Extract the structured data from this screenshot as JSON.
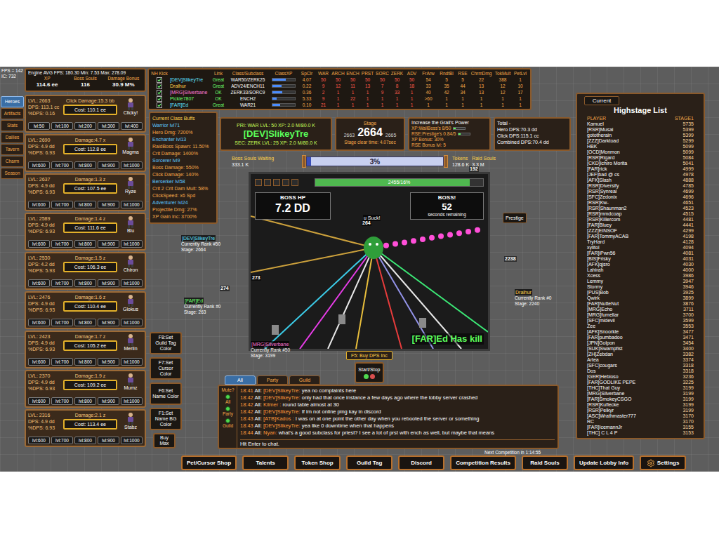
{
  "engine": {
    "fps": "FPS = 142",
    "ic": "IC: 732",
    "avg": "Engine AVG FPS: 180.30 Min: 7.53 Max: 278.09"
  },
  "summary": [
    {
      "label": "XP",
      "value": "114.6 ee"
    },
    {
      "label": "Boss Souls",
      "value": "116"
    },
    {
      "label": "Damage Bonus",
      "value": "30.9 M%"
    }
  ],
  "side_tabs": [
    {
      "label": "Heroes",
      "selected": true
    },
    {
      "label": "Artifacts",
      "selected": false
    },
    {
      "label": "Stats",
      "selected": false
    },
    {
      "label": "Dailies",
      "selected": false
    },
    {
      "label": "Tavern",
      "selected": false
    },
    {
      "label": "Charm",
      "selected": false
    },
    {
      "label": "Season",
      "selected": false
    }
  ],
  "heroes": [
    {
      "name": "Clicky!",
      "lvl": "LVL: 2663",
      "dps": "DPS: 113.1 cc",
      "pct": "%DPS: 0.16",
      "damage": "Click Damage:15.3 bb",
      "cost": "Cost: 110.1 ee",
      "levels": [
        "lvl:50",
        "lvl:100",
        "lvl:200",
        "lvl:300",
        "lvl:400"
      ]
    },
    {
      "name": "Magma",
      "lvl": "LVL: 2690",
      "dps": "DPS: 4.9 dd",
      "pct": "%DPS: 6.93",
      "damage": "Damage:4.7 x",
      "cost": "Cost: 112.8 ee",
      "levels": [
        "lvl:600",
        "lvl:700",
        "lvl:800",
        "lvl:900",
        "lvl:1000"
      ]
    },
    {
      "name": "Ryze",
      "lvl": "LVL: 2637",
      "dps": "DPS: 4.9 dd",
      "pct": "%DPS: 6.93",
      "damage": "Damage:1.3 z",
      "cost": "Cost: 107.5 ee",
      "levels": [
        "lvl:600",
        "lvl:700",
        "lvl:800",
        "lvl:900",
        "lvl:1000"
      ]
    },
    {
      "name": "Blu",
      "lvl": "LVL: 2589",
      "dps": "DPS: 4.9 dd",
      "pct": "%DPS: 6.93",
      "damage": "Damage:1.4 z",
      "cost": "Cost: 111.6 ee",
      "levels": [
        "lvl:600",
        "lvl:700",
        "lvl:800",
        "lvl:900",
        "lvl:1000"
      ]
    },
    {
      "name": "Chiron",
      "lvl": "LVL: 2530",
      "dps": "DPS: 4.2 dd",
      "pct": "%DPS: 5.93",
      "damage": "Damage:1.5 z",
      "cost": "Cost: 106.3 ee",
      "levels": [
        "lvl:600",
        "lvl:700",
        "lvl:800",
        "lvl:900",
        "lvl:1000"
      ]
    },
    {
      "name": "Glokus",
      "lvl": "LVL: 2476",
      "dps": "DPS: 4.9 dd",
      "pct": "%DPS: 6.93",
      "damage": "Damage:1.6 z",
      "cost": "Cost: 110.4 ee",
      "levels": [
        "lvl:600",
        "lvl:700",
        "lvl:800",
        "lvl:900",
        "lvl:1000"
      ]
    },
    {
      "name": "Merlin",
      "lvl": "LVL: 2423",
      "dps": "DPS: 4.9 dd",
      "pct": "%DPS: 6.93",
      "damage": "Damage:1.7 z",
      "cost": "Cost: 105.2 ee",
      "levels": [
        "lvl:600",
        "lvl:700",
        "lvl:800",
        "lvl:900",
        "lvl:1000"
      ]
    },
    {
      "name": "Mumz",
      "lvl": "LVL: 2370",
      "dps": "DPS: 4.9 dd",
      "pct": "%DPS: 6.93",
      "damage": "Damage:1.9 z",
      "cost": "Cost: 109.2 ee",
      "levels": [
        "lvl:600",
        "lvl:700",
        "lvl:800",
        "lvl:900",
        "lvl:1000"
      ]
    },
    {
      "name": "Stabz",
      "lvl": "LVL: 2316",
      "dps": "DPS: 4.9 dd",
      "pct": "%DPS: 6.93",
      "damage": "Damage:2.1 z",
      "cost": "Cost: 113.4 ee",
      "levels": [
        "lvl:600",
        "lvl:700",
        "lvl:800",
        "lvl:900",
        "lvl:1000"
      ]
    }
  ],
  "party": {
    "columns": [
      "NH Kick",
      "Link",
      "Class/Subclass",
      "ClassXP",
      "SpClr",
      "WAR",
      "ARCH",
      "ENCH",
      "PRST",
      "SORC",
      "ZERK",
      "ADV",
      "FrArw",
      "RndtBl",
      "RSE",
      "ChrmDmg",
      "TokMult",
      "PetLvl"
    ],
    "rows": [
      {
        "kick": true,
        "name": "[DEV]SlikeyTre",
        "color": "#5ee0ff",
        "link": "Great",
        "class": "WAR50/ZERK25",
        "level": 0.6,
        "values": [
          "4.07",
          "50",
          "50",
          "50",
          "50",
          "50",
          "50",
          "50",
          "54",
          "5",
          "5",
          "22",
          "388",
          "1"
        ]
      },
      {
        "kick": true,
        "name": "Dralhur",
        "color": "#ffd24a",
        "link": "Great",
        "class": "ADV24/ENCH11",
        "level": 0.4,
        "values": [
          "0.22",
          "9",
          "12",
          "11",
          "13",
          "7",
          "8",
          "18",
          "33",
          "35",
          "44",
          "13",
          "12",
          "10"
        ]
      },
      {
        "kick": true,
        "name": "[MRG]Silverbane",
        "color": "#ff7ad9",
        "link": "OK",
        "class": "ZERK33/SORC9",
        "level": 0.45,
        "values": [
          "0.36",
          "2",
          "1",
          "1",
          "1",
          "9",
          "33",
          "1",
          "40",
          "42",
          "34",
          "13",
          "12",
          "17"
        ]
      },
      {
        "kick": true,
        "name": "Pickle7807",
        "color": "#6dff6d",
        "link": "OK",
        "class": "ENCH2",
        "level": 0.2,
        "values": [
          "5.33",
          "9",
          "1",
          "22",
          "1",
          "1",
          "1",
          "1",
          ">60",
          "1",
          "1",
          "1",
          "1",
          "1"
        ]
      },
      {
        "kick": true,
        "name": "[FAR]Ed",
        "color": "#5ee0ff",
        "link": "Great",
        "class": "WAR21",
        "level": 0.35,
        "values": [
          "0.10",
          "21",
          "1",
          "1",
          "1",
          "1",
          "1",
          "1",
          "1",
          "1",
          "1",
          "1",
          "1",
          "1"
        ]
      }
    ]
  },
  "buffs": {
    "title": "Current Class Buffs",
    "lines": [
      {
        "text": "Warrior lvl71",
        "kind": "class"
      },
      {
        "text": "Hero Dmg: 7200%",
        "kind": "buff"
      },
      {
        "text": "Enchanter lvl13",
        "kind": "class"
      },
      {
        "text": "RaidBoss Spawn: 11.50%",
        "kind": "buff"
      },
      {
        "text": "Crit Damage: 1400%",
        "kind": "buff"
      },
      {
        "text": "Sorcerer lvl9",
        "kind": "class"
      },
      {
        "text": "Boss Damage: 550%",
        "kind": "buff"
      },
      {
        "text": "Click Damage: 140%",
        "kind": "buff"
      },
      {
        "text": "Berserker lvl58",
        "kind": "class"
      },
      {
        "text": "Crit 2 Crit Dam Mult: 58%",
        "kind": "buff"
      },
      {
        "text": "ClickSpeed: x6 Spd",
        "kind": "buff"
      },
      {
        "text": "Adventurer lvl24",
        "kind": "class"
      },
      {
        "text": "Projectile Dmg: 27%",
        "kind": "buff"
      },
      {
        "text": "XP Gain Inc: 3700%",
        "kind": "buff"
      }
    ]
  },
  "primary": {
    "pri": "PRI: WAR LVL: 50 XP: 2.0 M/80.0 K",
    "name": "[DEV]SlikeyTre",
    "sec": "SEC: ZERK LVL: 25 XP: 2.0 M/80.0 K"
  },
  "stage": {
    "label": "Stage",
    "prev": "2663",
    "current": "2664",
    "next": "2665",
    "clear": "Stage clear time: 4.07sec"
  },
  "grail": {
    "title": "Increase the Grail's Power",
    "bars": [
      {
        "text": "XP:WallBoss's 8/50",
        "level": 0.16
      },
      {
        "text": "RSE:Prestige's 0.84/5",
        "level": 0.17
      }
    ],
    "lines": [
      "XP Bonus: 30%",
      "RSE Bonus lvl: 5"
    ]
  },
  "total": {
    "title": "Total -",
    "lines": [
      "Hero DPS:70.3 dd",
      "Click DPS:115.1 cc",
      "Combined DPS:70.4 dd"
    ]
  },
  "souls": {
    "waiting": {
      "label": "Boss Souls Waiting",
      "value": "333.1 K"
    },
    "progress": {
      "label": "3%",
      "level": 0.03
    },
    "tokens": {
      "label": "Tokens",
      "value": "128.6 K"
    },
    "raid": {
      "label": "Raid Souls",
      "value": "3.3 M"
    }
  },
  "arena": {
    "hp_bar": {
      "label": "2455/16%",
      "level": 0.92
    },
    "boss_hp": {
      "label": "BOSS HP",
      "value": "7.2 DD"
    },
    "timer": {
      "label": "BOSS!",
      "value": "52",
      "caption": "seconds remaining"
    },
    "kill": "[FAR]Ed Has kill",
    "taunt": "u Suck!"
  },
  "prestige": "Prestige",
  "players": [
    {
      "name": "[DEV]SlikeyTre",
      "rank": "Currently Rank #50",
      "stage": "Stage: 2664",
      "color": "#5ee0ff"
    },
    {
      "name": "[FAR]Ed",
      "rank": "Currently Rank #0",
      "stage": "Stage: 263",
      "color": "#6dff6d"
    },
    {
      "name": "[MRG]Silverbane",
      "rank": "Currently Rank #50",
      "stage": "Stage: 3199",
      "color": "#ff7ad9"
    },
    {
      "name": "Dralhur",
      "rank": "Currently Rank #0",
      "stage": "Stage: 2240",
      "color": "#ffd24a"
    }
  ],
  "floaters": [
    "264",
    "273",
    "274",
    "2238",
    "192"
  ],
  "guild_buttons": [
    "F8:Set Guild Tag Color",
    "F7:Set Cursor Color",
    "F6:Set Name Color",
    "F1:Set Name BG Color"
  ],
  "buy": {
    "label": "Buy",
    "value": "Max"
  },
  "f5": "F5: Buy DPS Inc",
  "start_stop": "Start/Stop",
  "chat": {
    "tabs": [
      {
        "label": "All",
        "selected": true
      },
      {
        "label": "Party",
        "selected": false
      },
      {
        "label": "Guild",
        "selected": false
      }
    ],
    "mute": {
      "label": "Mute?",
      "options": [
        {
          "label": "All",
          "on": true
        },
        {
          "label": "Party",
          "on": true
        },
        {
          "label": "Guild",
          "on": true
        }
      ]
    },
    "messages": [
      {
        "time": "18:41",
        "channel": "All:",
        "name": "[DEV]SlikeyTre:",
        "text": "yea no complaints here"
      },
      {
        "time": "18:42",
        "channel": "All:",
        "name": "[DEV]SlikeyTre:",
        "text": "only had that once instance a few days ago where the lobby server crashed"
      },
      {
        "time": "18:42",
        "channel": "All:",
        "name": "Kilmer :",
        "text": "round table almost at 30"
      },
      {
        "time": "18:42",
        "channel": "All:",
        "name": "[DEV]SlikeyTre:",
        "text": "If im not online ping kay in discord"
      },
      {
        "time": "18:43",
        "channel": "All:",
        "name": "[ATB]Kados :",
        "text": "I was on at one point the other day when you rebooted the server or something"
      },
      {
        "time": "18:43",
        "channel": "All:",
        "name": "[DEV]SlikeyTre:",
        "text": "yea like 0 downtime when that happens"
      },
      {
        "time": "18:44",
        "channel": "All:",
        "name": "Nyan:",
        "text": "what's a good subclass for priest? I see a lot of prst with ench as well, but maybe that means"
      }
    ],
    "input": "Hit Enter to chat."
  },
  "highstage": {
    "button": "Current",
    "title": "Highstage List",
    "columns": [
      "PLAYER",
      "STAGE1"
    ],
    "rows": [
      {
        "player": "Kamuel",
        "stage": "5735"
      },
      {
        "player": "[RSR]Musai",
        "stage": "5399"
      },
      {
        "player": "gototherain",
        "stage": "5399"
      },
      {
        "player": "[ZZZ]Darktoad",
        "stage": "5299"
      },
      {
        "player": "HBK",
        "stage": "5099"
      },
      {
        "player": "[OCD]Monmon",
        "stage": "5099"
      },
      {
        "player": "[RSR]Rigard",
        "stage": "5084"
      },
      {
        "player": "[CKD]Ichiro Morita",
        "stage": "5041"
      },
      {
        "player": "[FAR]rick",
        "stage": "4999"
      },
      {
        "player": "[JEF]bad @ cs",
        "stage": "4978"
      },
      {
        "player": "[AFK]Slash",
        "stage": "4888"
      },
      {
        "player": "[RSR]Diversify",
        "stage": "4785"
      },
      {
        "player": "[RSR]Synreal",
        "stage": "4699"
      },
      {
        "player": "[SFC]Zedonix",
        "stage": "4696"
      },
      {
        "player": "[RSR]Kw-",
        "stage": "4651"
      },
      {
        "player": "[RSR]Shaunman2",
        "stage": "4523"
      },
      {
        "player": "[RSR]mmdcoap",
        "stage": "4515"
      },
      {
        "player": "[RSR]Killercom",
        "stage": "4481"
      },
      {
        "player": "[FAR]Bluey",
        "stage": "4441"
      },
      {
        "player": "[ZZZ]EINSOF",
        "stage": "4299"
      },
      {
        "player": "[FAR]TommyACAB",
        "stage": "4198"
      },
      {
        "player": "TryHard",
        "stage": "4128"
      },
      {
        "player": "xylitol",
        "stage": "4094"
      },
      {
        "player": "[FAR]iPwn56",
        "stage": "4081"
      },
      {
        "player": "[BIS]Frisky",
        "stage": "4031"
      },
      {
        "player": "[AFK]qjsro",
        "stage": "4030"
      },
      {
        "player": "Lahirah",
        "stage": "4000"
      },
      {
        "player": "Xcess",
        "stage": "3986"
      },
      {
        "player": "Lemmy",
        "stage": "3947"
      },
      {
        "player": "Stormy",
        "stage": "3946"
      },
      {
        "player": "[PUS]Bob",
        "stage": "3925"
      },
      {
        "player": "Qwirk",
        "stage": "3899"
      },
      {
        "player": "[FAR]NutteNut",
        "stage": "3876"
      },
      {
        "player": "[MRG]Echo",
        "stage": "3711"
      },
      {
        "player": "[MRG]fumellar",
        "stage": "3700"
      },
      {
        "player": "[SFC]midevil",
        "stage": "3599"
      },
      {
        "player": "Zee",
        "stage": "3553"
      },
      {
        "player": "[AFK]Snoorkle",
        "stage": "3477"
      },
      {
        "player": "[FAR]pumbadoo",
        "stage": "3471"
      },
      {
        "player": "[JPN]Golpon",
        "stage": "3454"
      },
      {
        "player": "[SUK]Swampfist",
        "stage": "3400"
      },
      {
        "player": "[ZH]Zebdan",
        "stage": "3382"
      },
      {
        "player": "Artea",
        "stage": "3374"
      },
      {
        "player": "[SFC]cougars",
        "stage": "3318"
      },
      {
        "player": "Dos",
        "stage": "3318"
      },
      {
        "player": "[GER]Hebioso",
        "stage": "3236"
      },
      {
        "player": "[FAR]GODLIKE PEPE",
        "stage": "3225"
      },
      {
        "player": "[THC]That Guy",
        "stage": "3199"
      },
      {
        "player": "[MRG]Silverbane",
        "stage": "3199"
      },
      {
        "player": "[FAR]SmokeyCSGO",
        "stage": "3199"
      },
      {
        "player": "[RSR]Kuflecke",
        "stage": "3199"
      },
      {
        "player": "[RSR]Pelkyr",
        "stage": "3199"
      },
      {
        "player": "[ASC]Wrathmaster777",
        "stage": "3170"
      },
      {
        "player": "RC",
        "stage": "3170"
      },
      {
        "player": "[FAR]IcemannJr",
        "stage": "3155"
      },
      {
        "player": "[THC] C L 4 P",
        "stage": "3153"
      }
    ]
  },
  "bottom": {
    "countdown": "Next Competition in 1:14:55",
    "buttons": [
      {
        "label": "Pet/Cursor Shop",
        "kind": "text"
      },
      {
        "label": "Talents",
        "kind": "text"
      },
      {
        "label": "Token Shop",
        "kind": "text"
      },
      {
        "label": "Guild Tag",
        "kind": "text"
      },
      {
        "label": "Discord",
        "kind": "text"
      },
      {
        "label": "Competition Results",
        "kind": "text"
      },
      {
        "label": "Raid Souls",
        "kind": "text"
      },
      {
        "label": "Update Lobby Info",
        "kind": "text"
      },
      {
        "label": "Settings",
        "kind": "gear"
      }
    ]
  }
}
